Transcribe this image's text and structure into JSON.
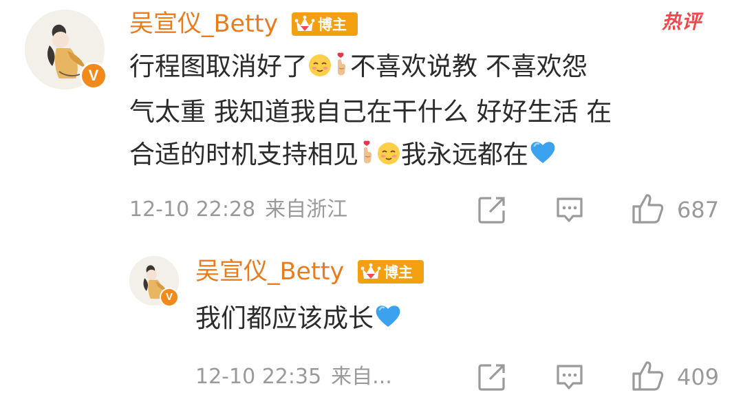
{
  "main_comment": {
    "username": "吴宣仪_Betty",
    "badge_label": "博主",
    "hot_label": "热评",
    "text_parts": [
      "行程图取消好了",
      "不喜欢说教 不喜欢怨\n气太重 我知道我自己在干什么 好好生活 在\n合适的时机支持相见",
      "我永远都在"
    ],
    "timestamp": "12-10 22:28",
    "location": "来自浙江",
    "like_count": "687",
    "icons": [
      "share-icon",
      "comment-icon",
      "like-icon"
    ]
  },
  "reply": {
    "username": "吴宣仪_Betty",
    "badge_label": "博主",
    "text": "我们都应该成长",
    "timestamp": "12-10 22:35",
    "location": "来自...",
    "like_count": "409",
    "icons": [
      "share-icon",
      "comment-icon",
      "like-icon"
    ]
  },
  "colors": {
    "username": "#eb7c1e",
    "badge": "#f2a012",
    "hot": "#f2474a",
    "meta": "#9a9a9a",
    "text": "#2b2b2b",
    "heart_blue": "#3aa2ee"
  }
}
